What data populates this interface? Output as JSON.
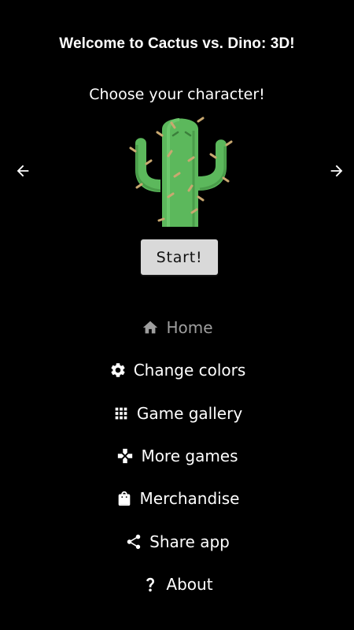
{
  "header": {
    "title": "Welcome to Cactus vs. Dino: 3D!",
    "subtitle": "Choose your character!"
  },
  "carousel": {
    "prev_icon": "arrow-left-icon",
    "next_icon": "arrow-right-icon",
    "character_icon": "cactus-icon"
  },
  "start_button": {
    "label": "Start!"
  },
  "menu": {
    "items": [
      {
        "label": "Home",
        "icon": "home-icon",
        "active": true
      },
      {
        "label": "Change colors",
        "icon": "gear-icon",
        "active": false
      },
      {
        "label": "Game gallery",
        "icon": "grid-icon",
        "active": false
      },
      {
        "label": "More games",
        "icon": "gamepad-icon",
        "active": false
      },
      {
        "label": "Merchandise",
        "icon": "shopping-bag-icon",
        "active": false
      },
      {
        "label": "Share app",
        "icon": "share-icon",
        "active": false
      },
      {
        "label": "About",
        "icon": "question-mark-icon",
        "active": false
      }
    ]
  },
  "colors": {
    "background": "#000000",
    "text": "#ffffff",
    "active_text": "#9e9e9e",
    "button_bg": "#d9d9d9",
    "cactus_green": "#5cb85c"
  }
}
